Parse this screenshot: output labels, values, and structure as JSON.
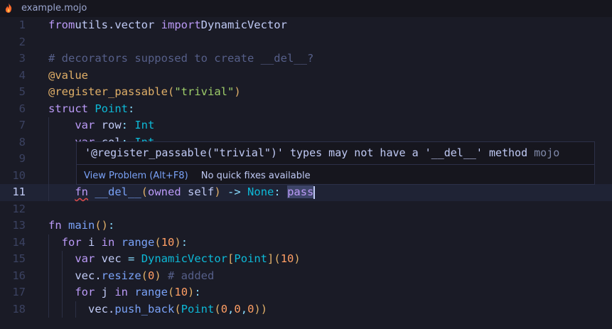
{
  "tab": {
    "filename": "example.mojo",
    "icon": "flame-icon"
  },
  "hover": {
    "message": "'@register_passable(\"trivial\")' types may not have a '__del__' method",
    "source": "mojo",
    "view_problem": "View Problem (Alt+F8)",
    "no_fixes": "No quick fixes available"
  },
  "editor": {
    "current_line": 11,
    "lines": [
      {
        "n": "1",
        "tokens": [
          [
            "kw",
            "from"
          ],
          [
            "",
            "utils.vector "
          ],
          [
            "kw",
            "import"
          ],
          [
            "",
            "DynamicVector"
          ]
        ]
      },
      {
        "n": "2",
        "tokens": []
      },
      {
        "n": "3",
        "tokens": [
          [
            "cm",
            "# decorators supposed to create __del__?"
          ]
        ]
      },
      {
        "n": "4",
        "tokens": [
          [
            "dec",
            "@value"
          ]
        ]
      },
      {
        "n": "5",
        "tokens": [
          [
            "dec",
            "@register_passable"
          ],
          [
            "br",
            "("
          ],
          [
            "str",
            "\"trivial\""
          ],
          [
            "br",
            ")"
          ]
        ]
      },
      {
        "n": "6",
        "tokens": [
          [
            "kw",
            "struct"
          ],
          [
            "",
            ""
          ],
          [
            "ty",
            "Point"
          ],
          [
            "op",
            ":"
          ]
        ]
      },
      {
        "n": "7",
        "tokens": [
          [
            "",
            "    "
          ],
          [
            "kw",
            "var"
          ],
          [
            "",
            " row"
          ],
          [
            "op",
            ":"
          ],
          [
            "",
            ""
          ],
          [
            "ty",
            "Int"
          ]
        ]
      },
      {
        "n": "8",
        "tokens": [
          [
            "",
            "    "
          ],
          [
            "kw",
            "var"
          ],
          [
            "",
            " col"
          ],
          [
            "op",
            ":"
          ],
          [
            "",
            ""
          ],
          [
            "ty",
            "Int"
          ]
        ]
      },
      {
        "n": "9",
        "tokens": []
      },
      {
        "n": "10",
        "tokens": []
      },
      {
        "n": "11",
        "tokens": [
          [
            "",
            "    "
          ],
          [
            "kw squig",
            "fn"
          ],
          [
            "",
            " "
          ],
          [
            "fn",
            "__del__"
          ],
          [
            "br",
            "("
          ],
          [
            "kw",
            "owned"
          ],
          [
            "",
            " self"
          ],
          [
            "br",
            ")"
          ],
          [
            "op",
            " ->"
          ],
          [
            "",
            " "
          ],
          [
            "ty",
            "None"
          ],
          [
            "op",
            ":"
          ],
          [
            "",
            " "
          ],
          [
            "kw sel",
            "pass"
          ],
          [
            "cursor",
            ""
          ]
        ]
      },
      {
        "n": "12",
        "tokens": []
      },
      {
        "n": "13",
        "tokens": [
          [
            "kw",
            "fn"
          ],
          [
            "",
            " "
          ],
          [
            "fn",
            "main"
          ],
          [
            "br",
            "()"
          ],
          [
            "op",
            ":"
          ]
        ]
      },
      {
        "n": "14",
        "tokens": [
          [
            "",
            "  "
          ],
          [
            "kw",
            "for"
          ],
          [
            "",
            " i "
          ],
          [
            "kw",
            "in"
          ],
          [
            "",
            " "
          ],
          [
            "fn",
            "range"
          ],
          [
            "br",
            "("
          ],
          [
            "num",
            "10"
          ],
          [
            "br",
            ")"
          ],
          [
            "op",
            ":"
          ]
        ]
      },
      {
        "n": "15",
        "tokens": [
          [
            "",
            "    "
          ],
          [
            "kw",
            "var"
          ],
          [
            "",
            " vec "
          ],
          [
            "op",
            "="
          ],
          [
            "",
            ""
          ],
          [
            "ty",
            "DynamicVector"
          ],
          [
            "br",
            "["
          ],
          [
            "ty",
            "Point"
          ],
          [
            "br",
            "]("
          ],
          [
            "num",
            "10"
          ],
          [
            "br",
            ")"
          ]
        ]
      },
      {
        "n": "16",
        "tokens": [
          [
            "",
            "    vec."
          ],
          [
            "fn",
            "resize"
          ],
          [
            "br",
            "("
          ],
          [
            "num",
            "0"
          ],
          [
            "br",
            ")"
          ],
          [
            "cm",
            " # added"
          ]
        ]
      },
      {
        "n": "17",
        "tokens": [
          [
            "",
            "    "
          ],
          [
            "kw",
            "for"
          ],
          [
            "",
            " j "
          ],
          [
            "kw",
            "in"
          ],
          [
            "",
            " "
          ],
          [
            "fn",
            "range"
          ],
          [
            "br",
            "("
          ],
          [
            "num",
            "10"
          ],
          [
            "br",
            ")"
          ],
          [
            "op",
            ":"
          ]
        ]
      },
      {
        "n": "18",
        "tokens": [
          [
            "",
            "      vec."
          ],
          [
            "fn",
            "push_back"
          ],
          [
            "br",
            "("
          ],
          [
            "ty",
            "Point"
          ],
          [
            "br",
            "("
          ],
          [
            "num",
            "0"
          ],
          [
            "op",
            ","
          ],
          [
            "num",
            "0"
          ],
          [
            "op",
            ","
          ],
          [
            "num",
            "0"
          ],
          [
            "br",
            "))"
          ]
        ]
      }
    ]
  }
}
